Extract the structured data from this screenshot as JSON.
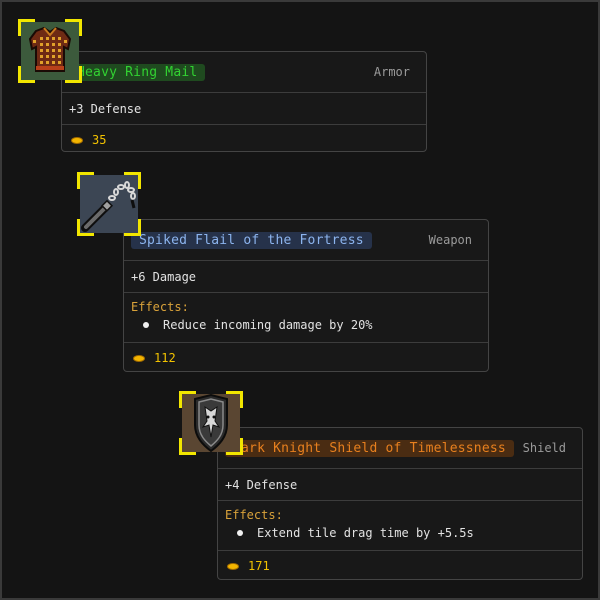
{
  "colors": {
    "frame_yellow": "#f2e600",
    "gold_text": "#f2c200",
    "effects_title": "#d9a23a",
    "common_green": "#32c832",
    "rare_blue": "#7fa6e0",
    "legendary_orange": "#e07a1a"
  },
  "items": [
    {
      "icon": "chest-armor-icon",
      "name": "Heavy Ring Mail",
      "type": "Armor",
      "stat": "+3 Defense",
      "gold": "35"
    },
    {
      "icon": "flail-icon",
      "name": "Spiked Flail of the Fortress",
      "type": "Weapon",
      "stat": "+6 Damage",
      "effects_title": "Effects:",
      "effects": [
        "Reduce incoming damage by 20%"
      ],
      "gold": "112"
    },
    {
      "icon": "shield-icon",
      "name": "Dark Knight Shield of Timelessness",
      "type": "Shield",
      "stat": "+4 Defense",
      "effects_title": "Effects:",
      "effects": [
        "Extend tile drag time by +5.5s"
      ],
      "gold": "171"
    }
  ]
}
